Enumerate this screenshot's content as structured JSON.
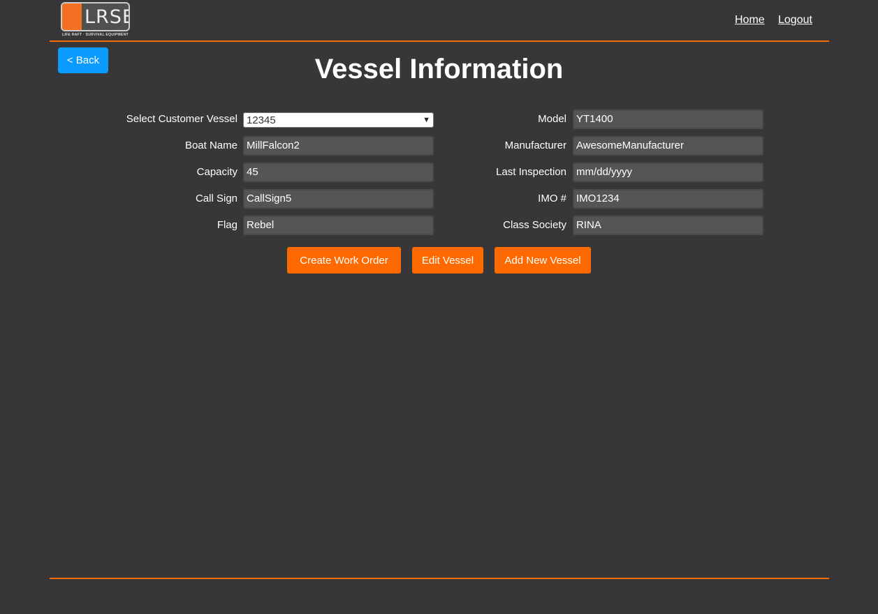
{
  "header": {
    "logo_text": "LRSE",
    "logo_tagline": "LIFE RAFT · SURVIVAL EQUIPMENT",
    "nav": {
      "home": "Home",
      "logout": "Logout"
    }
  },
  "back_label": "< Back",
  "title": "Vessel Information",
  "form": {
    "left": [
      {
        "label": "Select Customer Vessel",
        "value": "12345"
      },
      {
        "label": "Boat Name",
        "value": "MillFalcon2"
      },
      {
        "label": "Capacity",
        "value": "45"
      },
      {
        "label": "Call Sign",
        "value": "CallSign5"
      },
      {
        "label": "Flag",
        "value": "Rebel"
      }
    ],
    "right": [
      {
        "label": "Model",
        "value": "YT1400"
      },
      {
        "label": "Manufacturer",
        "value": "AwesomeManufacturer"
      },
      {
        "label": "Last Inspection",
        "value": "mm/dd/yyyy"
      },
      {
        "label": "IMO #",
        "value": "IMO1234"
      },
      {
        "label": "Class Society",
        "value": "RINA"
      }
    ]
  },
  "buttons": {
    "create": "Create Work Order",
    "edit": "Edit Vessel",
    "add": "Add New Vessel"
  },
  "colors": {
    "accent": "#ff6a00",
    "back": "#0a9bff",
    "bg": "#373737"
  }
}
